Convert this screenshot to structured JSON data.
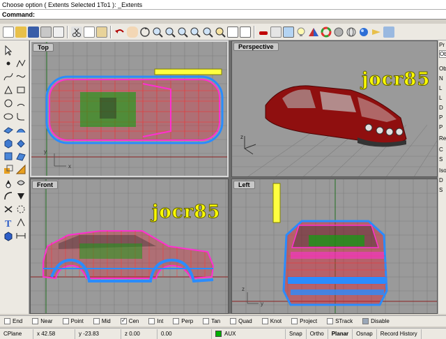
{
  "command_history": "Choose option ( Extents  Selected  1To1 ): _Extents",
  "command_prompt": "Command:",
  "viewports": {
    "top": {
      "label": "Top"
    },
    "perspective": {
      "label": "Perspective"
    },
    "front": {
      "label": "Front"
    },
    "left": {
      "label": "Left"
    }
  },
  "watermark": "jocr85",
  "axis_labels": {
    "x": "x",
    "y": "y",
    "z": "z"
  },
  "right_panel": {
    "items": [
      "Pr",
      "Ob",
      "Ob",
      "N",
      "L",
      "L",
      "D",
      "P",
      "P",
      "Re",
      "C",
      "S",
      "Iso",
      "D",
      "S"
    ]
  },
  "osnap": [
    {
      "label": "End",
      "checked": false
    },
    {
      "label": "Near",
      "checked": false
    },
    {
      "label": "Point",
      "checked": false
    },
    {
      "label": "Mid",
      "checked": false
    },
    {
      "label": "Cen",
      "checked": true
    },
    {
      "label": "Int",
      "checked": false
    },
    {
      "label": "Perp",
      "checked": false
    },
    {
      "label": "Tan",
      "checked": false
    },
    {
      "label": "Quad",
      "checked": false
    },
    {
      "label": "Knot",
      "checked": false
    },
    {
      "label": "Project",
      "checked": false
    },
    {
      "label": "STrack",
      "checked": false
    },
    {
      "label": "Disable",
      "checked": false
    }
  ],
  "status": {
    "cplane": "CPlane",
    "x": "x 42.58",
    "y": "y -23.83",
    "z": "z 0.00",
    "value": "0.00",
    "layer": "AUX",
    "layer_color": "#00b000",
    "toggles": [
      "Snap",
      "Ortho",
      "Planar",
      "Osnap",
      "Record History"
    ]
  }
}
